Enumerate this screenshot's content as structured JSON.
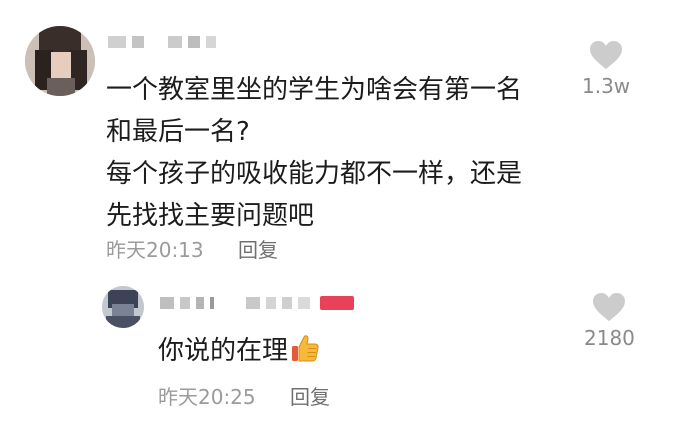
{
  "comments": [
    {
      "text_lines": [
        "一个教室里坐的学生为啥会有第一名",
        "和最后一名?",
        "每个孩子的吸收能力都不一样，还是",
        "先找找主要问题吧"
      ],
      "time": "昨天20:13",
      "reply_label": "回复",
      "likes": "1.3w"
    },
    {
      "text": "你说的在理",
      "emoji": "thumbs-up-emoji",
      "time": "昨天20:25",
      "reply_label": "回复",
      "likes": "2180"
    }
  ],
  "colors": {
    "text": "#1c1c1c",
    "meta": "#9b9b9b",
    "like_icon": "#cccccc",
    "badge": "#e8425a"
  },
  "icons": {
    "like": "heart-icon"
  }
}
